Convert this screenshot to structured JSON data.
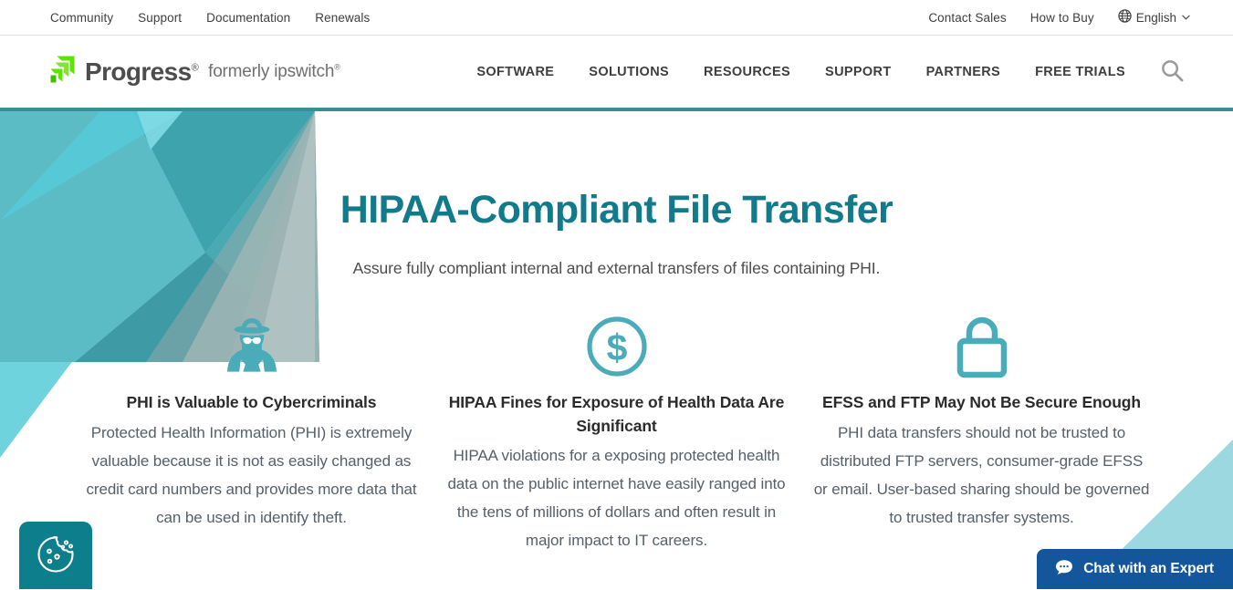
{
  "utility_bar": {
    "left_links": [
      {
        "label": "Community"
      },
      {
        "label": "Support"
      },
      {
        "label": "Documentation"
      },
      {
        "label": "Renewals"
      }
    ],
    "right_links": [
      {
        "label": "Contact Sales"
      },
      {
        "label": "How to Buy"
      }
    ],
    "language": {
      "icon": "globe-icon",
      "label": "English",
      "caret": "⌄"
    }
  },
  "header": {
    "brand": {
      "mark_icon": "progress-logo-mark",
      "name": "Progress",
      "registered": "®",
      "tagline": "formerly ipswitch",
      "tagline_registered": "®"
    },
    "nav_items": [
      {
        "label": "SOFTWARE"
      },
      {
        "label": "SOLUTIONS"
      },
      {
        "label": "RESOURCES"
      },
      {
        "label": "SUPPORT"
      },
      {
        "label": "PARTNERS"
      },
      {
        "label": "FREE TRIALS"
      }
    ],
    "search": {
      "icon": "search-icon"
    },
    "accent_border_color": "#3b8e97"
  },
  "hero": {
    "title": "HIPAA-Compliant File Transfer",
    "subtitle": "Assure fully compliant internal and external transfers of files containing PHI.",
    "title_color": "#117a8b",
    "cards": [
      {
        "icon": "spy-icon",
        "title": "PHI is Valuable to Cybercriminals",
        "body": "Protected Health Information (PHI) is extremely valuable because it is not as easily changed as credit card numbers and provides more data that can be used in identify theft."
      },
      {
        "icon": "dollar-circle-icon",
        "title": "HIPAA Fines for Exposure of Health Data Are Significant",
        "body": "HIPAA violations for a exposing protected health data on the public internet have easily ranged into the tens of millions of dollars and often result in major impact to IT careers."
      },
      {
        "icon": "padlock-icon",
        "title": "EFSS and FTP May Not Be Secure Enough",
        "body": "PHI data transfers should not be trusted to distributed FTP servers, consumer-grade EFSS or email. User-based sharing should be governed to trusted transfer systems."
      }
    ]
  },
  "widgets": {
    "cookie_consent": {
      "icon": "cookie-icon",
      "background_color": "#0d7f8c"
    },
    "chat": {
      "icon": "chat-bubble-icon",
      "label": "Chat with an Expert",
      "background_color": "#13569c"
    }
  }
}
